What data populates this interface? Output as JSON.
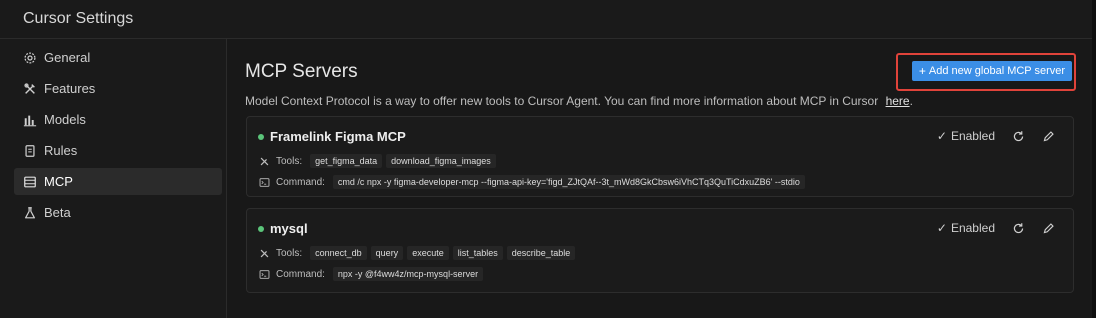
{
  "window": {
    "title": "Cursor Settings"
  },
  "sidebar": {
    "items": [
      {
        "label": "General",
        "icon": "gear-icon",
        "active": false
      },
      {
        "label": "Features",
        "icon": "tools-icon",
        "active": false
      },
      {
        "label": "Models",
        "icon": "bar-chart-icon",
        "active": false
      },
      {
        "label": "Rules",
        "icon": "document-icon",
        "active": false
      },
      {
        "label": "MCP",
        "icon": "server-icon",
        "active": true
      },
      {
        "label": "Beta",
        "icon": "flask-icon",
        "active": false
      }
    ]
  },
  "main": {
    "title": "MCP Servers",
    "description": "Model Context Protocol is a way to offer new tools to Cursor Agent. You can find more information about MCP in Cursor",
    "description_link": "here",
    "description_end": ".",
    "add_button_label": "Add new global MCP server",
    "servers": [
      {
        "name": "Framelink Figma MCP",
        "status": "Enabled",
        "tools_label": "Tools:",
        "tools": [
          "get_figma_data",
          "download_figma_images"
        ],
        "command_label": "Command:",
        "command": "cmd /c npx -y figma-developer-mcp --figma-api-key='figd_ZJtQAf--3t_mWd8GkCbsw6iVhCTq3QuTiCdxuZB6' --stdio"
      },
      {
        "name": "mysql",
        "status": "Enabled",
        "tools_label": "Tools:",
        "tools": [
          "connect_db",
          "query",
          "execute",
          "list_tables",
          "describe_table"
        ],
        "command_label": "Command:",
        "command": "npx -y @f4ww4z/mcp-mysql-server"
      }
    ]
  },
  "colors": {
    "accent": "#3b8ee6",
    "highlight_border": "#e0433a",
    "enabled_dot": "#5bc57a"
  }
}
